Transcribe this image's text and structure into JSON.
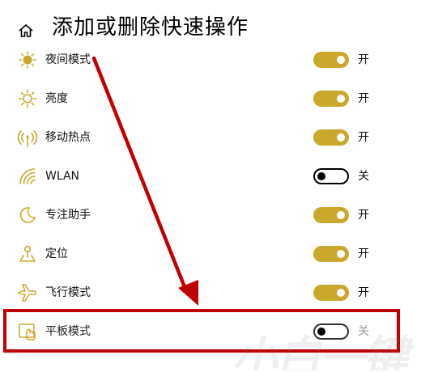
{
  "header": {
    "title": "添加或删除快速操作",
    "home_icon": "home-icon"
  },
  "colors": {
    "toggle_on": "#c9a82c",
    "icon_gold": "#c9a82c",
    "annotation_red": "#c00000"
  },
  "settings": [
    {
      "label": "夜间模式",
      "icon": "night-light-icon",
      "state": "开",
      "on": true
    },
    {
      "label": "亮度",
      "icon": "brightness-icon",
      "state": "开",
      "on": true
    },
    {
      "label": "移动热点",
      "icon": "mobile-hotspot-icon",
      "state": "开",
      "on": true
    },
    {
      "label": "WLAN",
      "icon": "wifi-icon",
      "state": "关",
      "on": false
    },
    {
      "label": "专注助手",
      "icon": "focus-assist-moon-icon",
      "state": "开",
      "on": true
    },
    {
      "label": "定位",
      "icon": "location-icon",
      "state": "开",
      "on": true
    },
    {
      "label": "飞行模式",
      "icon": "airplane-icon",
      "state": "开",
      "on": true
    },
    {
      "label": "平板模式",
      "icon": "tablet-mode-icon",
      "state": "关",
      "on": false
    }
  ],
  "watermark": "小白一键"
}
